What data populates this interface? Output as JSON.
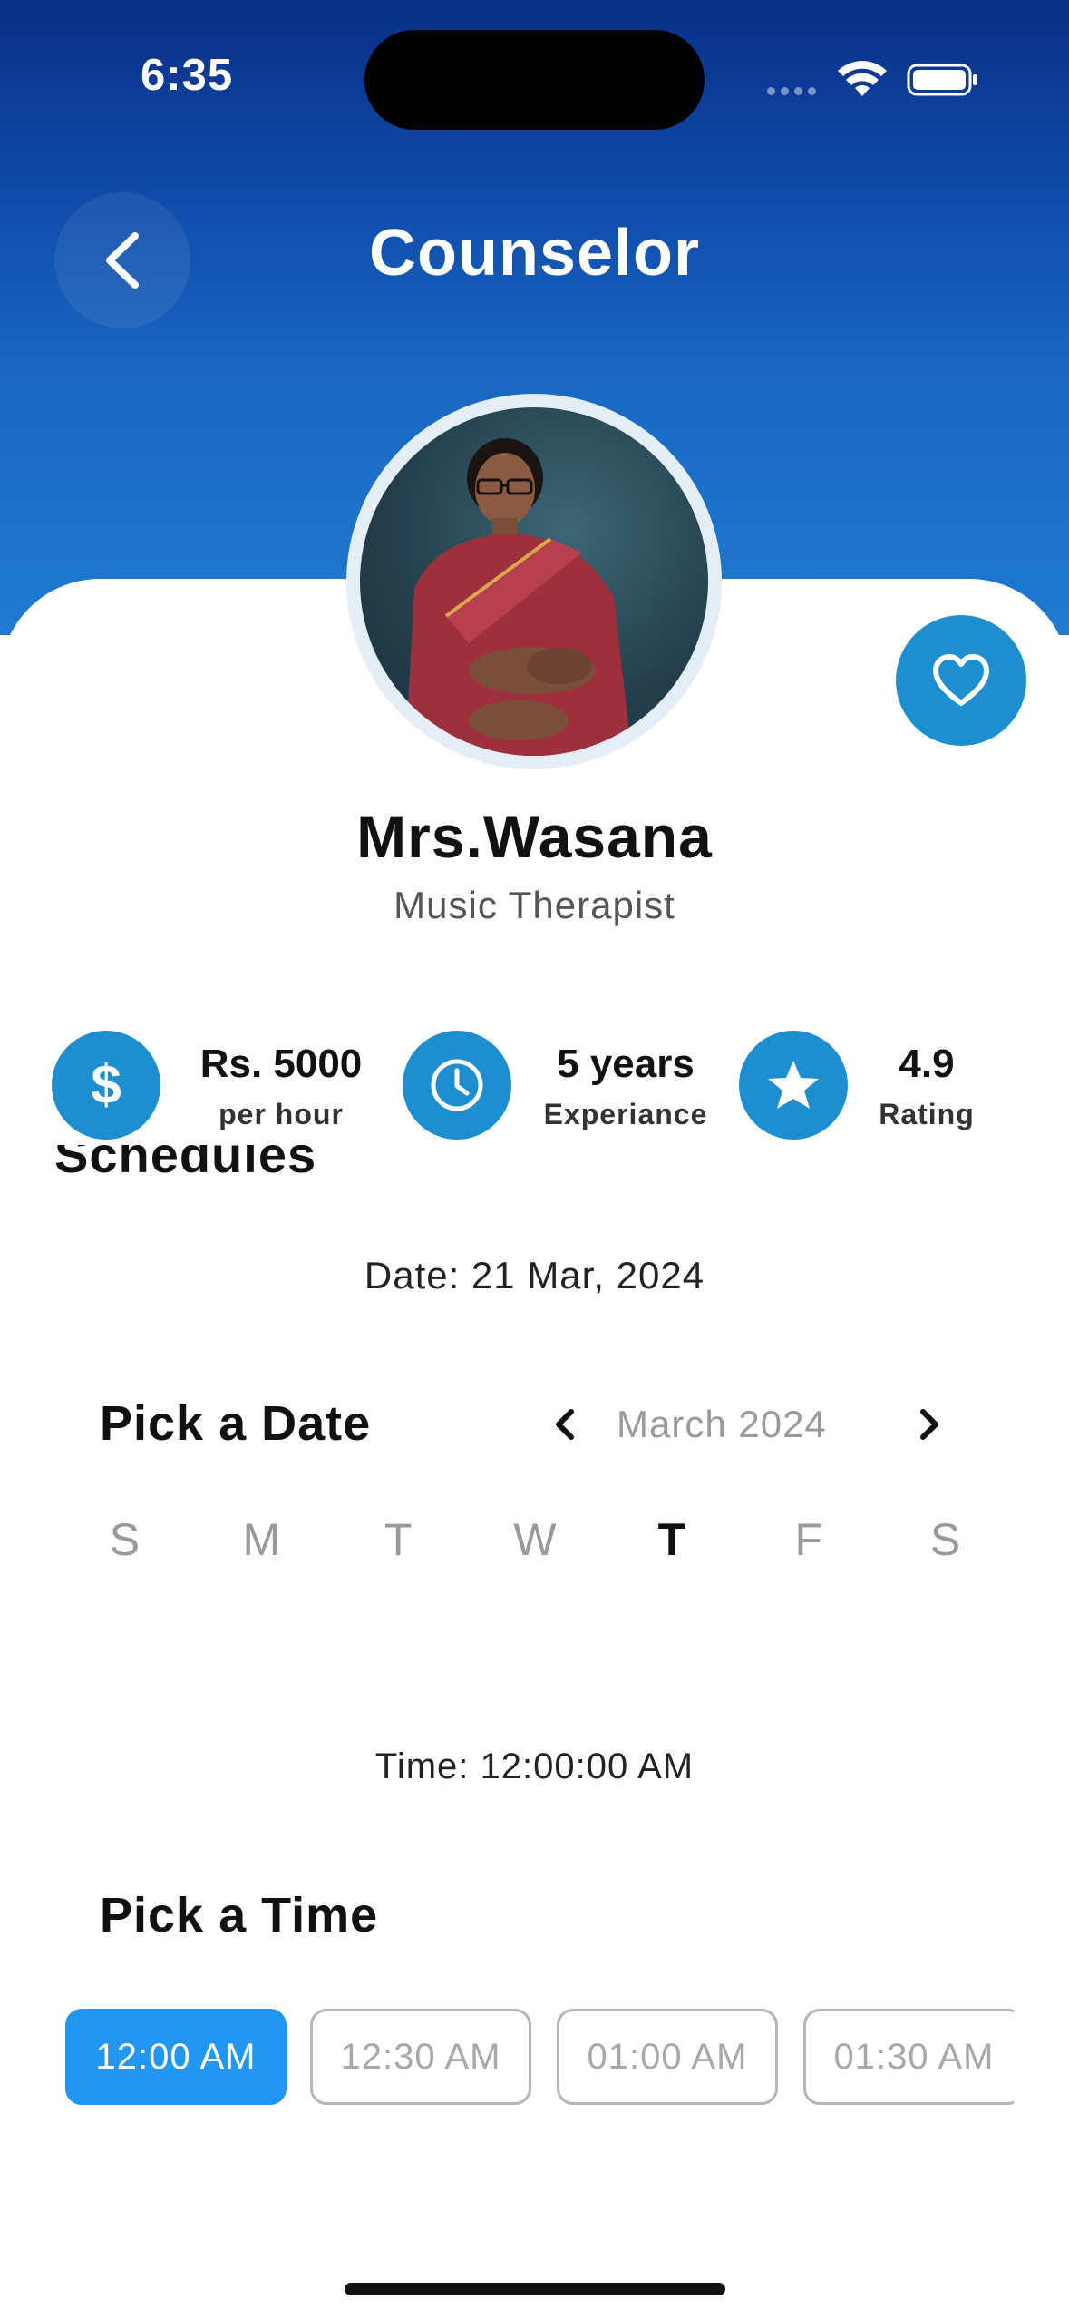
{
  "status_bar": {
    "time": "6:35"
  },
  "header": {
    "title": "Counselor"
  },
  "profile": {
    "name": "Mrs.Wasana",
    "role": "Music Therapist"
  },
  "stats": [
    {
      "value": "Rs. 5000",
      "label": "per hour",
      "icon": "dollar-icon"
    },
    {
      "value": "5 years",
      "label": "Experiance",
      "icon": "clock-icon"
    },
    {
      "value": "4.9",
      "label": "Rating",
      "icon": "star-icon"
    }
  ],
  "schedules": {
    "heading": "Schedules",
    "date_line": "Date: 21 Mar, 2024",
    "pick_date_title": "Pick a Date",
    "month_label": "March 2024",
    "weekdays": [
      "S",
      "M",
      "T",
      "W",
      "T",
      "F",
      "S"
    ],
    "active_weekday_index": 4,
    "time_line": "Time: 12:00:00 AM",
    "pick_time_title": "Pick a Time",
    "time_slots": [
      "12:00 AM",
      "12:30 AM",
      "01:00 AM",
      "01:30 AM"
    ],
    "selected_slot_index": 0
  },
  "colors": {
    "header_gradient_top": "#0a2f86",
    "header_gradient_bottom": "#1f7ad0",
    "accent": "#1d8fd0",
    "selected_slot": "#2196f3"
  }
}
